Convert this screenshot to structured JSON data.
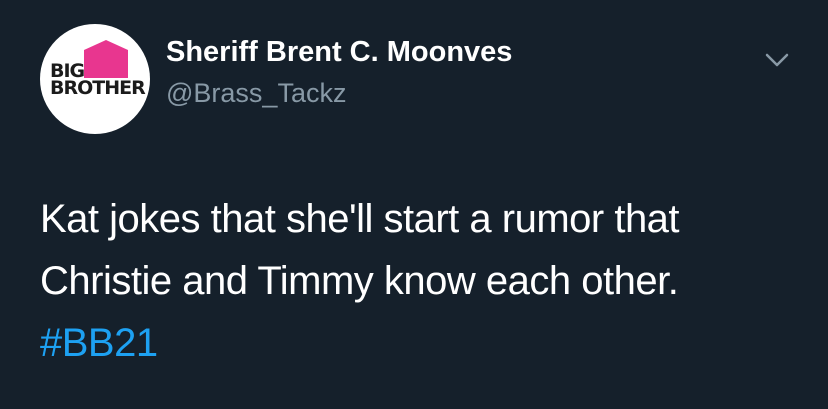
{
  "tweet": {
    "avatar": {
      "logo_line1": "BIG",
      "logo_line2": "BROTHER",
      "accent_color": "#e8368f"
    },
    "display_name": "Sheriff Brent C. Moonves",
    "handle": "@Brass_Tackz",
    "menu_icon": "chevron-down-icon",
    "text_line1": "Kat jokes that she'll start a rumor that",
    "text_line2": "Christie and Timmy know each other.",
    "hashtag": "#BB21",
    "colors": {
      "background": "#15202b",
      "text": "#ffffff",
      "secondary_text": "#8899a6",
      "link": "#1da1f2"
    }
  }
}
